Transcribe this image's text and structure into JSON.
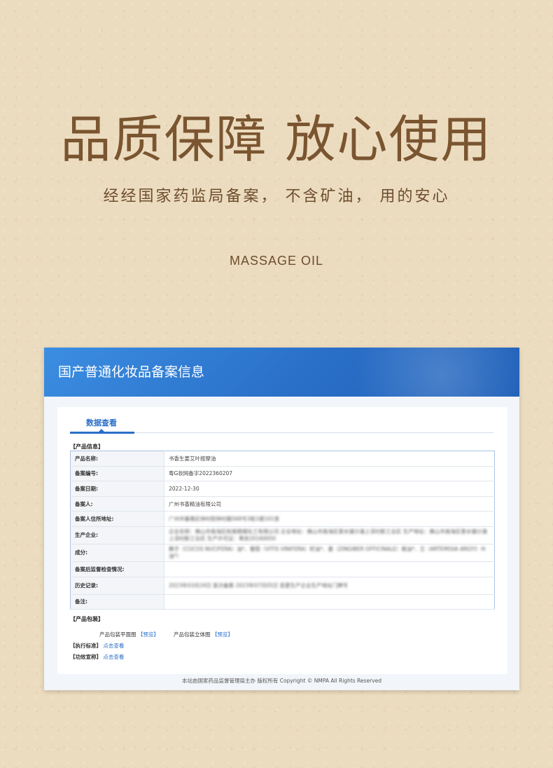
{
  "hero": {
    "title": "品质保障 放心使用",
    "subtitle": "经经国家药监局备案，  不含矿油，  用的安心",
    "english": "MASSAGE OIL"
  },
  "card": {
    "title": "国产普通化妆品备案信息",
    "tab_label": "数据查看",
    "section_product_info": "【产品信息】",
    "rows": [
      {
        "label": "产品名称:",
        "value": "书香生姜艾叶按摩油"
      },
      {
        "label": "备案编号:",
        "value": "粤G妆网备字2022360207"
      },
      {
        "label": "备案日期:",
        "value": "2022-12-30"
      },
      {
        "label": "备案人:",
        "value": "广州书香精油有限公司"
      },
      {
        "label": "备案人住所地址:",
        "value": "广州市番禺区钟村街钟村路568号3栋1楼101室"
      },
      {
        "label": "生产企业:",
        "value": "企业名称：佛山市南海区和美精细化工有限公司 企业地址：佛山市南海区里水镇沙涌上淳村新工业区 生产地址：佛山市南海区里水镇沙涌上淳村新工业区 生产许可证：粤妆20160050"
      },
      {
        "label": "成分:",
        "value": "椰子（COCOS NUCIFERA）油*、葡萄（VITIS VINIFERA）籽油*、姜（ZINGIBER OFFICINALE）根油*、艾（ARTEMISIA ARGYI）叶油*）"
      },
      {
        "label": "备案后监督检查情况:",
        "value": ""
      },
      {
        "label": "历史记录:",
        "value": "2023年03月24日 首次备案 2023年07月05日 变更生产企业生产地址门牌号"
      },
      {
        "label": "备注:",
        "value": ""
      }
    ],
    "section_packaging": "【产品包装】",
    "pack_flat_label": "产品包装平面图",
    "pack_flat_link": "【预览】",
    "pack_3d_label": "产品包装立体图",
    "pack_3d_link": "【预览】",
    "standard_label": "【执行标准】",
    "standard_link": "点击查看",
    "efficacy_label": "【功效宣称】",
    "efficacy_link": "点击查看",
    "footer": "本站由国家药品监督管理局主办 版权所有 Copyright © NMPA All Rights Reserved"
  },
  "colors": {
    "background": "#ecdcbf",
    "title_brown": "#7a5530",
    "header_blue": "#2a6fc8",
    "link_blue": "#2a6fc8"
  }
}
